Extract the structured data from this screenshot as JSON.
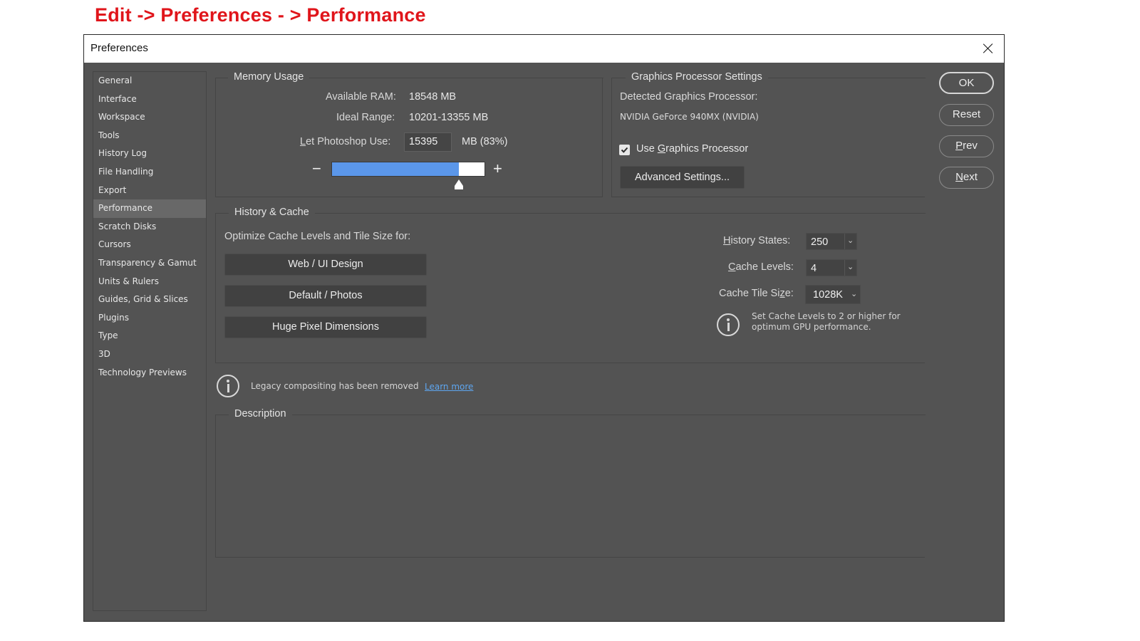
{
  "annotation": "Edit -> Preferences - > Performance",
  "window": {
    "title": "Preferences",
    "close_icon": "close-icon"
  },
  "sidebar": {
    "items": [
      {
        "label": "General"
      },
      {
        "label": "Interface"
      },
      {
        "label": "Workspace"
      },
      {
        "label": "Tools"
      },
      {
        "label": "History Log"
      },
      {
        "label": "File Handling"
      },
      {
        "label": "Export"
      },
      {
        "label": "Performance",
        "active": true
      },
      {
        "label": "Scratch Disks"
      },
      {
        "label": "Cursors"
      },
      {
        "label": "Transparency & Gamut"
      },
      {
        "label": "Units & Rulers"
      },
      {
        "label": "Guides, Grid & Slices"
      },
      {
        "label": "Plugins"
      },
      {
        "label": "Type"
      },
      {
        "label": "3D"
      },
      {
        "label": "Technology Previews"
      }
    ]
  },
  "memory": {
    "title": "Memory Usage",
    "available_label": "Available RAM:",
    "available_value": "18548 MB",
    "ideal_label": "Ideal Range:",
    "ideal_value": "10201-13355 MB",
    "use_label_mnemonic": "L",
    "use_label_rest": "et Photoshop Use:",
    "use_value": "15395",
    "use_suffix": "MB (83%)",
    "slider_percent": 83,
    "minus": "−",
    "plus": "+",
    "slider_color": "#5b97ea"
  },
  "gpu": {
    "title": "Graphics Processor Settings",
    "detected_label": "Detected Graphics Processor:",
    "detected_value": "NVIDIA GeForce 940MX (NVIDIA)",
    "use_gpu_pre": "Use ",
    "use_gpu_mnemonic": "G",
    "use_gpu_post": "raphics Processor",
    "use_gpu_checked": true,
    "advanced_button": "Advanced Settings..."
  },
  "history_cache": {
    "title": "History & Cache",
    "optimize_label": "Optimize Cache Levels and Tile Size for:",
    "preset_buttons": [
      "Web / UI Design",
      "Default / Photos",
      "Huge Pixel Dimensions"
    ],
    "history_states_mnemonic": "H",
    "history_states_rest": "istory States:",
    "history_states_value": "250",
    "cache_levels_mnemonic": "C",
    "cache_levels_rest": "ache Levels:",
    "cache_levels_value": "4",
    "tile_size_pre": "Cache Tile Si",
    "tile_size_mnemonic": "z",
    "tile_size_post": "e:",
    "tile_size_value": "1028K",
    "info_line1": "Set Cache Levels to 2 or higher for",
    "info_line2": "optimum GPU performance."
  },
  "legacy": {
    "message": "Legacy compositing has been removed",
    "link": "Learn more",
    "link_color": "#5ea6f0"
  },
  "description": {
    "title": "Description",
    "body": ""
  },
  "buttons": {
    "ok": "OK",
    "reset": "Reset",
    "prev_mnemonic": "P",
    "prev_rest": "rev",
    "next_mnemonic": "N",
    "next_rest": "ext"
  },
  "accent_colors": {
    "annotation": "#e0151b",
    "dialog_bg": "#535353"
  }
}
